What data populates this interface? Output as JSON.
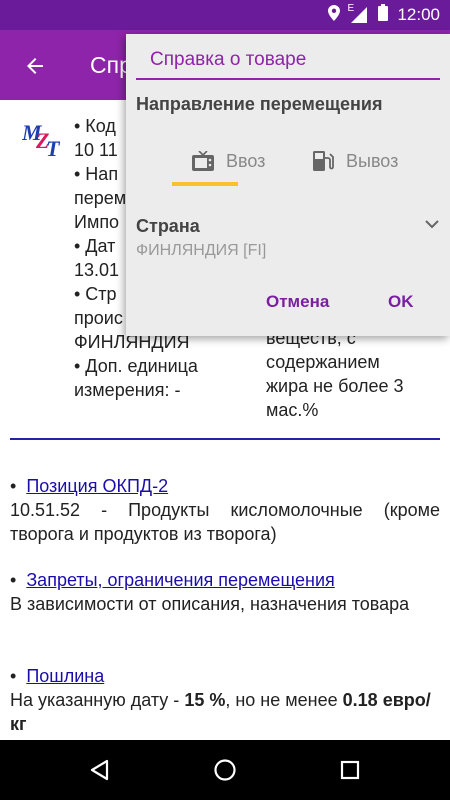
{
  "status_bar": {
    "network": "E",
    "time": "12:00"
  },
  "app_bar": {
    "title": "Справка о товаре"
  },
  "dialog": {
    "search_placeholder": "Справка о товаре",
    "direction_label": "Направление перемещения",
    "tabs": [
      {
        "label": "Ввоз",
        "icon": "tv-icon",
        "selected": true
      },
      {
        "label": "Вывоз",
        "icon": "fuel-pump-icon",
        "selected": false
      }
    ],
    "country_label": "Страна",
    "country_value": "ФИНЛЯНДИЯ [FI]",
    "cancel_label": "Отмена",
    "ok_label": "OK",
    "accent_color": "#8e24aa",
    "tab_indicator_color": "#fbc02d"
  },
  "details": {
    "left_rows": [
      "• Код",
      "10 11",
      "• Нап",
      "переме",
      "Импо",
      "• Дат",
      "13.01",
      "• Стр",
      "проис",
      "ФИНЛЯНДИЯ",
      "• Доп. единица",
      "измерения: -"
    ],
    "right_lines": [
      "веществ, с",
      "содержанием",
      "жира не более 3",
      "мас.%"
    ]
  },
  "sections": [
    {
      "link": "Позиция ОКПД-2",
      "body": "10.51.52 - Продукты кисломолочные (кроме творога и продуктов из творога)"
    },
    {
      "link": "Запреты, ограничения перемещения",
      "body": "В зависимости от описания, назначения товара"
    },
    {
      "link": "Пошлина",
      "body_prefix": "На указанную дату -",
      "rate": "15 %",
      "body_mid": ", но не менее",
      "min_amount": "0.18",
      "unit": "евро/кг"
    }
  ]
}
